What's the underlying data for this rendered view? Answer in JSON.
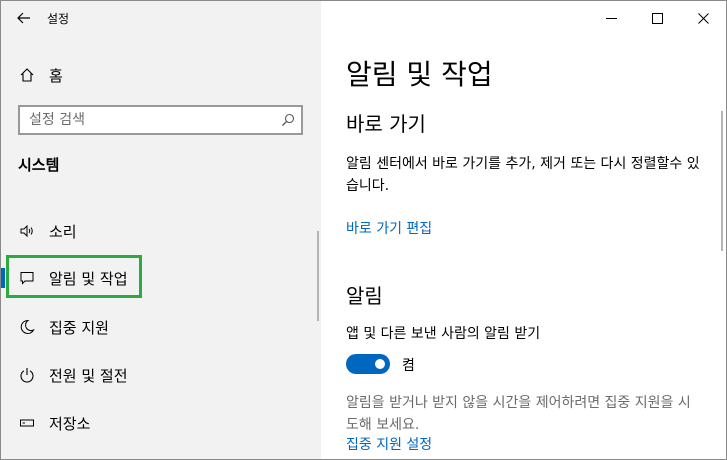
{
  "window": {
    "title": "설정"
  },
  "sidebar": {
    "home_label": "홈",
    "search_placeholder": "설정 검색",
    "section_title": "시스템",
    "items": [
      {
        "label": "소리",
        "icon": "speaker-icon"
      },
      {
        "label": "알림 및 작업",
        "icon": "message-icon",
        "active": true
      },
      {
        "label": "집중 지원",
        "icon": "moon-icon"
      },
      {
        "label": "전원 및 절전",
        "icon": "power-icon"
      },
      {
        "label": "저장소",
        "icon": "storage-icon"
      }
    ]
  },
  "main": {
    "title": "알림 및 작업",
    "quick_actions": {
      "heading": "바로 가기",
      "description": "알림 센터에서 바로 가기를 추가, 제거 또는 다시 정렬할수 있습니다.",
      "edit_link": "바로 가기 편집"
    },
    "notifications": {
      "heading": "알림",
      "toggle_label": "앱 및 다른 보낸 사람의 알림 받기",
      "toggle_state": "켬",
      "toggle_on": true,
      "focus_description": "알림을 받거나 받지 않을 시간을 제어하려면 집중 지원을 시도해 보세요.",
      "focus_link": "집중 지원 설정"
    }
  },
  "colors": {
    "accent": "#0067c0",
    "highlight": "#2bab3f",
    "sidebar_bg": "#f2f2f2"
  }
}
